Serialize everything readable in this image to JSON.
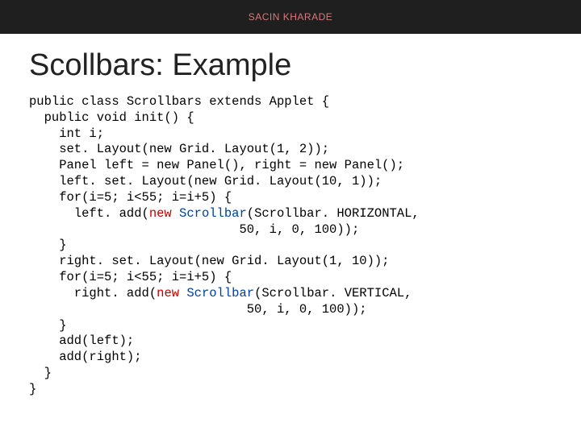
{
  "header": {
    "author": "SACIN KHARADE"
  },
  "title": "Scollbars: Example",
  "code": {
    "l1": "public class Scrollbars extends Applet {",
    "l2": "  public void init() {",
    "l3": "    int i;",
    "l4": "    set. Layout(new Grid. Layout(1, 2));",
    "l5": "    Panel left = new Panel(), right = new Panel();",
    "l6": "    left. set. Layout(new Grid. Layout(10, 1));",
    "l7": "    for(i=5; i<55; i=i+5) {",
    "l8a": "      left. add(",
    "l8b": "new ",
    "l8c": "Scrollbar",
    "l8d": "(Scrollbar. HORIZONTAL,",
    "l9": "                            50, i, 0, 100));",
    "l10": "    }",
    "l11": "    right. set. Layout(new Grid. Layout(1, 10));",
    "l12": "    for(i=5; i<55; i=i+5) {",
    "l13a": "      right. add(",
    "l13b": "new ",
    "l13c": "Scrollbar",
    "l13d": "(Scrollbar. VERTICAL,",
    "l14": "                             50, i, 0, 100));",
    "l15": "    }",
    "l16": "    add(left);",
    "l17": "    add(right);",
    "l18": "  }",
    "l19": "}"
  }
}
